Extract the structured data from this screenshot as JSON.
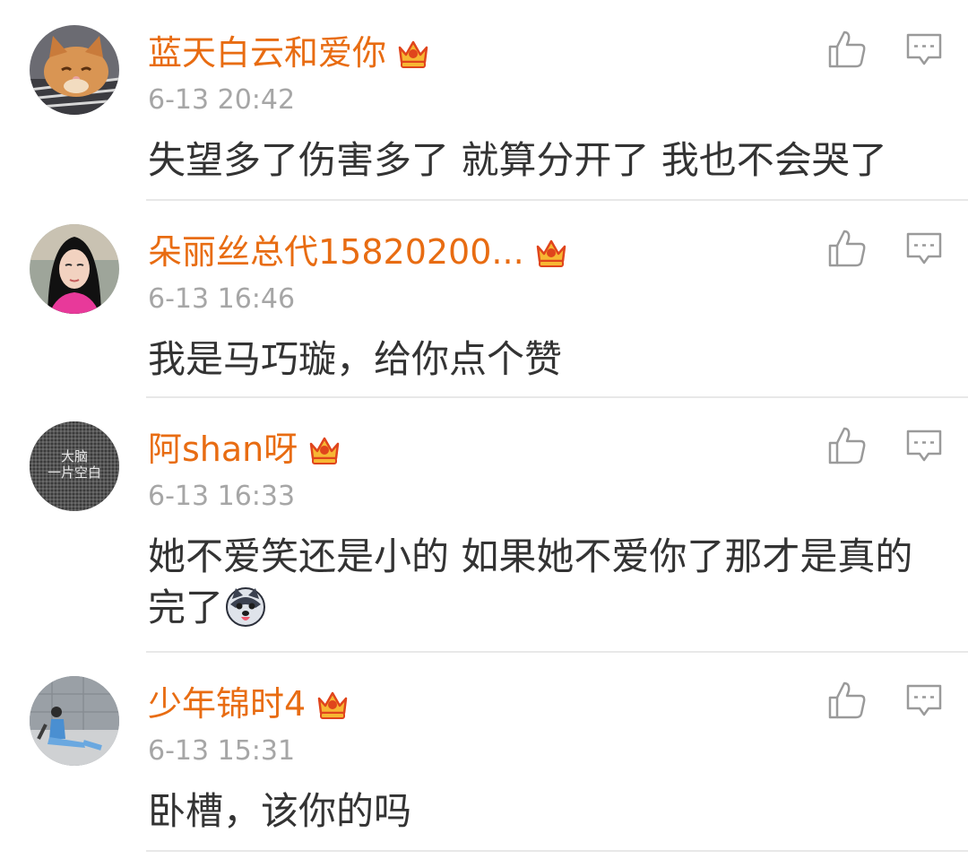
{
  "comments": [
    {
      "username": "蓝天白云和爱你",
      "timestamp": "6-13 20:42",
      "text": "失望多了伤害多了 就算分开了 我也不会哭了",
      "avatar_icon": "cat-avatar-icon",
      "vip_icon": "vip-crown-icon"
    },
    {
      "username": "朵丽丝总代15820200...",
      "timestamp": "6-13 16:46",
      "text": "我是马巧璇，给你点个赞",
      "avatar_icon": "woman-avatar-icon",
      "vip_icon": "vip-crown-icon"
    },
    {
      "username": "阿shan呀",
      "timestamp": "6-13 16:33",
      "text": "她不爱笑还是小的 如果她不爱你了那才是真的完了",
      "avatar_icon": "text-avatar-icon",
      "avatar_text_line1": "大脑",
      "avatar_text_line2": "一片空白",
      "vip_icon": "vip-crown-icon",
      "emoji_icon": "husky-emoji-icon"
    },
    {
      "username": "少年锦时4",
      "timestamp": "6-13 15:31",
      "text": "卧槽，该你的吗",
      "avatar_icon": "person-sitting-avatar-icon",
      "vip_icon": "vip-crown-icon"
    }
  ],
  "colors": {
    "username": "#e86c12",
    "timestamp": "#a6a6a6",
    "content": "#333333",
    "divider": "#e8e8e8",
    "icon": "#9a9a9a"
  }
}
